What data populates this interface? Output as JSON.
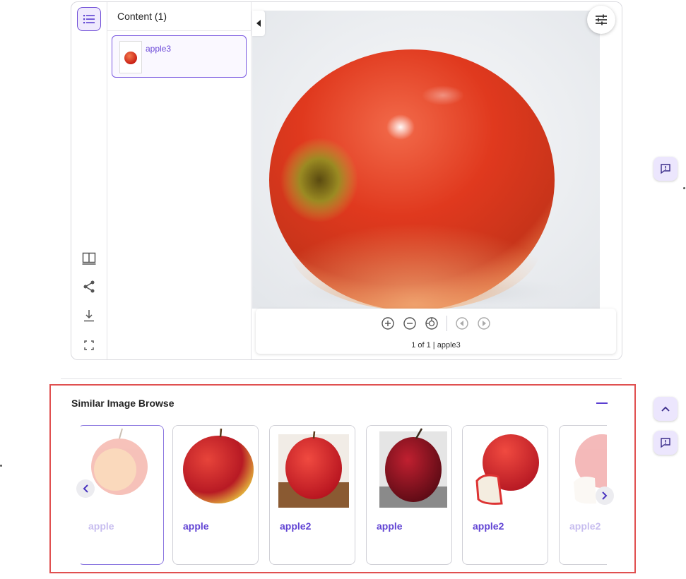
{
  "viewer": {
    "content_title": "Content (1)",
    "content_item_label": "apple3",
    "page_indicator": "1 of 1 | apple3"
  },
  "similar": {
    "title": "Similar Image Browse",
    "cards": [
      {
        "label": "apple"
      },
      {
        "label": "apple"
      },
      {
        "label": "apple2"
      },
      {
        "label": "apple"
      },
      {
        "label": "apple2"
      },
      {
        "label": "apple2"
      }
    ]
  },
  "colors": {
    "accent": "#6b48d8",
    "highlight_border": "#e05050",
    "fab_bg": "#ece6fd"
  },
  "icons": {
    "rail": [
      "list-icon",
      "book-icon",
      "share-icon",
      "download-icon",
      "fullscreen-icon"
    ],
    "toolbar": [
      "zoom-in-icon",
      "zoom-out-icon",
      "reset-zoom-icon",
      "prev-page-icon",
      "next-page-icon"
    ],
    "floating": [
      "feedback-icon",
      "scroll-up-icon",
      "feedback-icon"
    ]
  }
}
